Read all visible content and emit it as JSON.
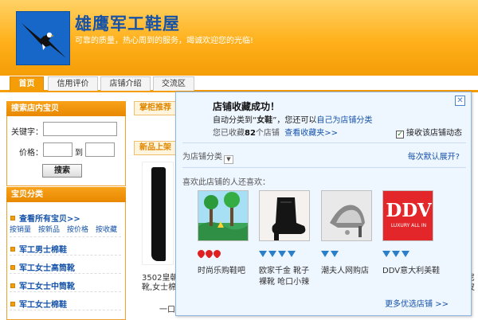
{
  "header": {
    "shop_name": "雄鹰军工鞋屋",
    "slogan": "可靠的质量，热心周到的服务，竭诚欢迎您的光临!"
  },
  "nav": {
    "tabs": [
      {
        "label": "首页"
      },
      {
        "label": "信用评价"
      },
      {
        "label": "店铺介绍"
      },
      {
        "label": "交流区"
      }
    ]
  },
  "sidebar": {
    "search_title": "搜索店内宝贝",
    "keyword_label": "关键字：",
    "price_label": "价格：",
    "price_to": "到",
    "search_button": "搜索",
    "category_title": "宝贝分类",
    "view_all": "查看所有宝贝>>",
    "sort_links": [
      "按销量",
      "按新品",
      "按价格",
      "按收藏"
    ],
    "categories": [
      "军工男士棉鞋",
      "军工女士高筒靴",
      "军工女士中筒靴",
      "军工女士棉鞋"
    ]
  },
  "main": {
    "recommend_label": "掌柜推荐",
    "new_label": "新品上架",
    "product_line1": "3502皇朝",
    "product_line2": "靴,女士棉",
    "product_line3": "一口",
    "right_frag1": "尼",
    "right_frag2": "皮"
  },
  "popup": {
    "title": "店铺收藏成功！",
    "line1_prefix": "自动分类到“",
    "line1_category": "女鞋",
    "line1_mid": "”，您还可以",
    "line1_link": "自己为店铺分类",
    "line2_prefix": "您已收藏",
    "line2_count": "82",
    "line2_suffix": "个店铺",
    "line2_link": "查看收藏夹>>",
    "subscribe_label": "接收该店铺动态",
    "subscribe_checked": "✓",
    "category_select_label": "为店铺分类",
    "expand_link": "每次默认展开?",
    "also_like": "喜欢此店铺的人还喜欢：",
    "shops": [
      {
        "name": "时尚乐购鞋吧",
        "rating_type": "heart",
        "rating_count": 3
      },
      {
        "name": "欧家千金 靴子 裸靴 呛口小辣",
        "name_line1": "欧家千金 靴子",
        "name_line2": "裸靴 呛口小辣",
        "rating_type": "gem",
        "rating_count": 4
      },
      {
        "name": "潮夫人网购店",
        "rating_type": "gem",
        "rating_count": 2
      },
      {
        "name": "DDV意大利美鞋",
        "rating_type": "gem",
        "rating_count": 3
      }
    ],
    "ddv_logo_text": "DDV",
    "ddv_logo_sub": "LUXURY ALL IN",
    "more_link": "更多优选店铺 >>",
    "close_glyph": "✕"
  },
  "colors": {
    "accent_orange": "#f49d07",
    "link_blue": "#1552a8",
    "popup_bg": "#eef6ff",
    "popup_border": "#8fb5e0"
  }
}
